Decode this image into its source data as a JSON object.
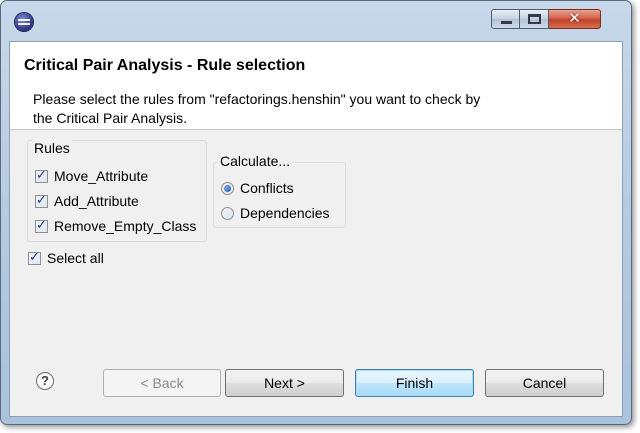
{
  "window": {
    "title_bar_buttons": {
      "minimize": "minimize-icon",
      "maximize": "maximize-icon",
      "close": "close-icon"
    },
    "close_glyph": "✕"
  },
  "header": {
    "title": "Critical Pair Analysis - Rule selection",
    "description": "Please select the rules from \"refactorings.henshin\" you want to check by the Critical Pair Analysis."
  },
  "rules": {
    "legend": "Rules",
    "items": [
      {
        "label": "Move_Attribute",
        "checked": true
      },
      {
        "label": "Add_Attribute",
        "checked": true
      },
      {
        "label": "Remove_Empty_Class",
        "checked": true
      }
    ]
  },
  "calculate": {
    "legend": "Calculate...",
    "options": [
      {
        "label": "Conflicts",
        "selected": true
      },
      {
        "label": "Dependencies",
        "selected": false
      }
    ]
  },
  "select_all": {
    "label": "Select all",
    "checked": true
  },
  "buttons": {
    "help": "?",
    "back": "< Back",
    "next": "Next >",
    "finish": "Finish",
    "cancel": "Cancel"
  },
  "colors": {
    "title_bar": "#b9cde3",
    "dialog_bg": "#f0f0f0",
    "default_button_border": "#3c7fb1"
  }
}
